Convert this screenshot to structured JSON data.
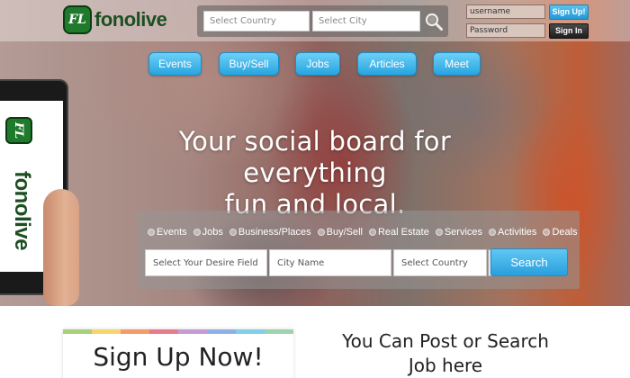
{
  "header": {
    "logo_mark": "FL",
    "logo_text": "fonolive",
    "search": {
      "country_placeholder": "Select Country",
      "city_placeholder": "Select City"
    },
    "login": {
      "username_value": "username",
      "password_value": "Password",
      "signup_label": "Sign Up!",
      "signin_label": "Sign In"
    }
  },
  "nav": {
    "items": [
      {
        "label": "Events"
      },
      {
        "label": "Buy/Sell"
      },
      {
        "label": "Jobs"
      },
      {
        "label": "Articles"
      },
      {
        "label": "Meet"
      }
    ]
  },
  "hero": {
    "headline_line1": "Your social board for everything",
    "headline_line2": "fun and local.",
    "phone_logo_mark": "FL",
    "phone_logo_text": "fonolive"
  },
  "search_panel": {
    "categories": [
      "Events",
      "Jobs",
      "Business/Places",
      "Buy/Sell",
      "Real Estate",
      "Services",
      "Activities",
      "Deals"
    ],
    "desire_field": "Select Your Desire Field",
    "city_field": "City Name",
    "country_field": "Select Country",
    "search_button": "Search"
  },
  "bottom": {
    "signup_title": "Sign Up Now!",
    "post_line1": "You Can Post or Search",
    "post_line2": "Job here",
    "stripe_colors": [
      "#a7d17a",
      "#f6d56b",
      "#f39b6b",
      "#e97a8a",
      "#c49bd4",
      "#8fb0e6",
      "#7fd0e8",
      "#9fd3b0"
    ]
  },
  "colors": {
    "accent": "#2ea6e0",
    "brand_green": "#1f7a2b"
  }
}
